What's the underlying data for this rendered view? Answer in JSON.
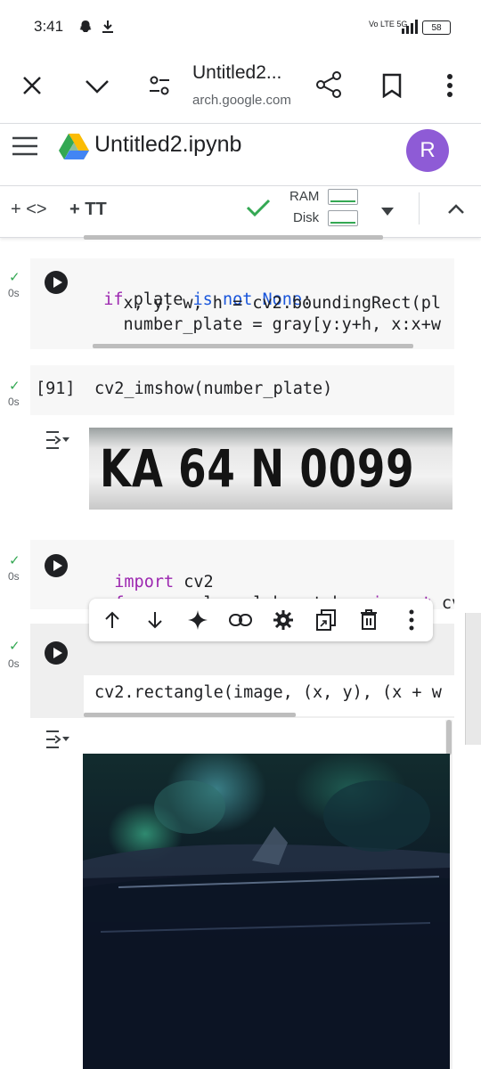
{
  "status_bar": {
    "time": "3:41",
    "network": "Vo LTE 5G",
    "battery": "58"
  },
  "browser": {
    "tab_title": "Untitled2...",
    "url": "arch.google.com"
  },
  "colab": {
    "notebook_title": "Untitled2.ipynb",
    "avatar_letter": "R",
    "toolbar": {
      "add_code": "+ <>",
      "add_text": "+ TT",
      "ram_label": "RAM",
      "disk_label": "Disk"
    }
  },
  "cells": [
    {
      "time": "0s",
      "lines": [
        {
          "parts": [
            {
              "t": "if",
              "c": "kw"
            },
            {
              "t": " plate ",
              "c": ""
            },
            {
              "t": "is not None",
              "c": "kw2"
            },
            {
              "t": ":",
              "c": ""
            }
          ]
        },
        {
          "parts": [
            {
              "t": "    x, y, w, h = cv2.boundingRect(pl",
              "c": ""
            }
          ]
        },
        {
          "parts": [
            {
              "t": "    number_plate = gray[y:y+h, x:x+w",
              "c": ""
            }
          ]
        }
      ]
    },
    {
      "time": "0s",
      "exec_count": "[91]",
      "code": "cv2_imshow(number_plate)",
      "output_text": "KA 64 N 0099"
    },
    {
      "time": "0s",
      "lines": [
        {
          "parts": [
            {
              "t": "import",
              "c": "kw"
            },
            {
              "t": " cv2",
              "c": ""
            }
          ]
        },
        {
          "parts": [
            {
              "t": "from",
              "c": "kw"
            },
            {
              "t": " google.colab.patches ",
              "c": ""
            },
            {
              "t": "import",
              "c": "kw"
            },
            {
              "t": " cv",
              "c": ""
            }
          ]
        }
      ]
    },
    {
      "time": "0s",
      "code": "cv2.rectangle(image, (x, y), (x + w"
    }
  ],
  "cell_toolbar": [
    "arrow-up-icon",
    "arrow-down-icon",
    "sparkle-icon",
    "link-icon",
    "gear-icon",
    "mirror-cell-icon",
    "delete-icon",
    "more-vert-icon"
  ]
}
